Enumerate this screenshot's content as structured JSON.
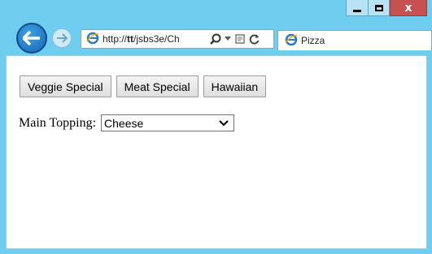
{
  "browser": {
    "address_prefix": "http://",
    "address_host": "tt",
    "address_rest": "/jsbs3e/Ch",
    "tab_title": "Pizza"
  },
  "page": {
    "buttons": [
      "Veggie Special",
      "Meat Special",
      "Hawaiian"
    ],
    "topping_label": "Main Topping:",
    "topping_selected": "Cheese"
  },
  "colors": {
    "frame": "#6fcdef",
    "close_button": "#c75050",
    "back_button": "#1466b4"
  }
}
